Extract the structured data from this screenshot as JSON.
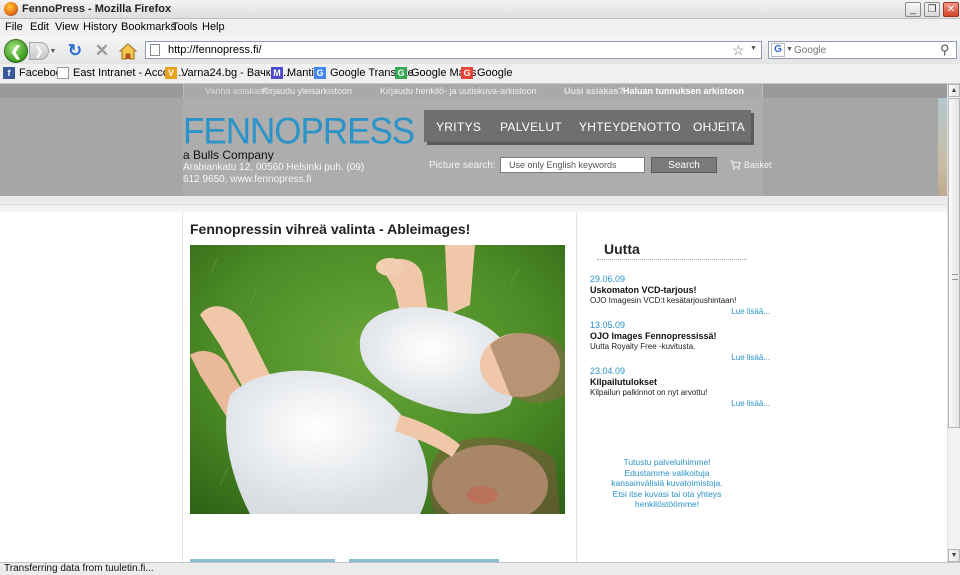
{
  "window": {
    "title": "FennoPress - Mozilla Firefox",
    "minimize": "_",
    "restore": "❐",
    "close": "✕"
  },
  "menu": [
    "File",
    "Edit",
    "View",
    "History",
    "Bookmarks",
    "Tools",
    "Help"
  ],
  "nav": {
    "url": "http://fennopress.fi/",
    "search_placeholder": "Google",
    "search_engine": "G"
  },
  "bookmarks": [
    {
      "label": "Facebook",
      "icon": "facebook-icon",
      "color": "#3b5998",
      "glyph": "f"
    },
    {
      "label": "East Intranet - Accou...",
      "icon": "page-icon",
      "color": "#ffffff",
      "glyph": ""
    },
    {
      "label": "Varna24.bg - Вачко ...",
      "icon": "varna-icon",
      "color": "#e8a317",
      "glyph": "V"
    },
    {
      "label": "Mantis",
      "icon": "mantis-icon",
      "color": "#4a4acb",
      "glyph": "M"
    },
    {
      "label": "Google Translate",
      "icon": "google-icon",
      "color": "#4285f4",
      "glyph": "G"
    },
    {
      "label": "Google Maps",
      "icon": "google-icon",
      "color": "#4285f4",
      "glyph": "G"
    },
    {
      "label": "Google",
      "icon": "google-icon",
      "color": "#4285f4",
      "glyph": "G"
    }
  ],
  "site": {
    "top_links": {
      "old_customer_label": "Vanha asiakas?",
      "old_customer_link": "Kirjaudu yleisarkistoon",
      "login_archive": "Kirjaudu henkilö- ja uutiskuva-arkistoon",
      "new_customer_label": "Uusi asiakas?",
      "new_customer_link": "Haluan tunnuksen arkistoon"
    },
    "logo": "FENNOPRESS",
    "tagline": "a Bulls Company",
    "address": "Arabiankatu 12, 00560 Helsinki puh. (09) 612 9650, www.fennopress.fi",
    "menu": [
      "YRITYS",
      "PALVELUT",
      "YHTEYDENOTTO",
      "OHJEITA"
    ],
    "picture_search_label": "Picture search:",
    "picture_search_placeholder": "Use only English keywords",
    "search_button": "Search",
    "basket": "Basket",
    "main_title": "Fennopressin vihreä valinta - Ableimages!",
    "news_heading": "Uutta",
    "news": [
      {
        "date": "29.06.09",
        "headline": "Uskomaton VCD-tarjous!",
        "text": "OJO Imagesin VCD:t kesätarjoushintaan!",
        "more": "Lue lisää..."
      },
      {
        "date": "13.05.09",
        "headline": "OJO Images Fennopressissä!",
        "text": "Uutta Royalty Free -kuvitusta.",
        "more": "Lue lisää..."
      },
      {
        "date": "23.04.09",
        "headline": "Kilpailutulokset",
        "text": "Kilpailun palkinnot on nyt arvottu!",
        "more": "Lue lisää..."
      }
    ],
    "promo_text": "Tutustu palveluihimme! Edustamme valikoituja kansainvälisiä kuvatoimistoja. Etsi itse kuvasi tai ota yhteys henkilöstöömme!"
  },
  "status": "Transferring data from tuuletin.fi..."
}
